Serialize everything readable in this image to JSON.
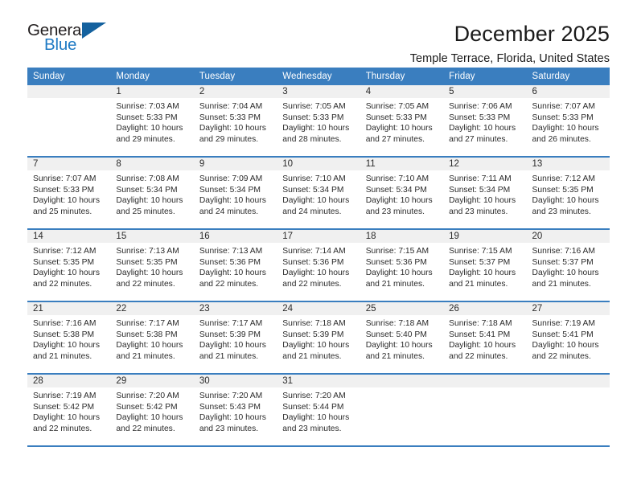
{
  "logo": {
    "word_top": "General",
    "word_bottom": "Blue",
    "triangle_color": "#14619e",
    "blue_color": "#1f7ac4"
  },
  "header": {
    "title": "December 2025",
    "location": "Temple Terrace, Florida, United States"
  },
  "theme": {
    "header_bar": "#3a7ebf",
    "daynum_strip": "#f0f0f0",
    "separator": "#3a7ebf"
  },
  "weekdays": [
    "Sunday",
    "Monday",
    "Tuesday",
    "Wednesday",
    "Thursday",
    "Friday",
    "Saturday"
  ],
  "labels": {
    "sunrise_prefix": "Sunrise:",
    "sunset_prefix": "Sunset:",
    "daylight_prefix": "Daylight:"
  },
  "weeks": [
    [
      {
        "day": "",
        "sunrise": "",
        "sunset": "",
        "daylight_line1": "",
        "daylight_line2": ""
      },
      {
        "day": "1",
        "sunrise": "Sunrise: 7:03 AM",
        "sunset": "Sunset: 5:33 PM",
        "daylight_line1": "Daylight: 10 hours",
        "daylight_line2": "and 29 minutes."
      },
      {
        "day": "2",
        "sunrise": "Sunrise: 7:04 AM",
        "sunset": "Sunset: 5:33 PM",
        "daylight_line1": "Daylight: 10 hours",
        "daylight_line2": "and 29 minutes."
      },
      {
        "day": "3",
        "sunrise": "Sunrise: 7:05 AM",
        "sunset": "Sunset: 5:33 PM",
        "daylight_line1": "Daylight: 10 hours",
        "daylight_line2": "and 28 minutes."
      },
      {
        "day": "4",
        "sunrise": "Sunrise: 7:05 AM",
        "sunset": "Sunset: 5:33 PM",
        "daylight_line1": "Daylight: 10 hours",
        "daylight_line2": "and 27 minutes."
      },
      {
        "day": "5",
        "sunrise": "Sunrise: 7:06 AM",
        "sunset": "Sunset: 5:33 PM",
        "daylight_line1": "Daylight: 10 hours",
        "daylight_line2": "and 27 minutes."
      },
      {
        "day": "6",
        "sunrise": "Sunrise: 7:07 AM",
        "sunset": "Sunset: 5:33 PM",
        "daylight_line1": "Daylight: 10 hours",
        "daylight_line2": "and 26 minutes."
      }
    ],
    [
      {
        "day": "7",
        "sunrise": "Sunrise: 7:07 AM",
        "sunset": "Sunset: 5:33 PM",
        "daylight_line1": "Daylight: 10 hours",
        "daylight_line2": "and 25 minutes."
      },
      {
        "day": "8",
        "sunrise": "Sunrise: 7:08 AM",
        "sunset": "Sunset: 5:34 PM",
        "daylight_line1": "Daylight: 10 hours",
        "daylight_line2": "and 25 minutes."
      },
      {
        "day": "9",
        "sunrise": "Sunrise: 7:09 AM",
        "sunset": "Sunset: 5:34 PM",
        "daylight_line1": "Daylight: 10 hours",
        "daylight_line2": "and 24 minutes."
      },
      {
        "day": "10",
        "sunrise": "Sunrise: 7:10 AM",
        "sunset": "Sunset: 5:34 PM",
        "daylight_line1": "Daylight: 10 hours",
        "daylight_line2": "and 24 minutes."
      },
      {
        "day": "11",
        "sunrise": "Sunrise: 7:10 AM",
        "sunset": "Sunset: 5:34 PM",
        "daylight_line1": "Daylight: 10 hours",
        "daylight_line2": "and 23 minutes."
      },
      {
        "day": "12",
        "sunrise": "Sunrise: 7:11 AM",
        "sunset": "Sunset: 5:34 PM",
        "daylight_line1": "Daylight: 10 hours",
        "daylight_line2": "and 23 minutes."
      },
      {
        "day": "13",
        "sunrise": "Sunrise: 7:12 AM",
        "sunset": "Sunset: 5:35 PM",
        "daylight_line1": "Daylight: 10 hours",
        "daylight_line2": "and 23 minutes."
      }
    ],
    [
      {
        "day": "14",
        "sunrise": "Sunrise: 7:12 AM",
        "sunset": "Sunset: 5:35 PM",
        "daylight_line1": "Daylight: 10 hours",
        "daylight_line2": "and 22 minutes."
      },
      {
        "day": "15",
        "sunrise": "Sunrise: 7:13 AM",
        "sunset": "Sunset: 5:35 PM",
        "daylight_line1": "Daylight: 10 hours",
        "daylight_line2": "and 22 minutes."
      },
      {
        "day": "16",
        "sunrise": "Sunrise: 7:13 AM",
        "sunset": "Sunset: 5:36 PM",
        "daylight_line1": "Daylight: 10 hours",
        "daylight_line2": "and 22 minutes."
      },
      {
        "day": "17",
        "sunrise": "Sunrise: 7:14 AM",
        "sunset": "Sunset: 5:36 PM",
        "daylight_line1": "Daylight: 10 hours",
        "daylight_line2": "and 22 minutes."
      },
      {
        "day": "18",
        "sunrise": "Sunrise: 7:15 AM",
        "sunset": "Sunset: 5:36 PM",
        "daylight_line1": "Daylight: 10 hours",
        "daylight_line2": "and 21 minutes."
      },
      {
        "day": "19",
        "sunrise": "Sunrise: 7:15 AM",
        "sunset": "Sunset: 5:37 PM",
        "daylight_line1": "Daylight: 10 hours",
        "daylight_line2": "and 21 minutes."
      },
      {
        "day": "20",
        "sunrise": "Sunrise: 7:16 AM",
        "sunset": "Sunset: 5:37 PM",
        "daylight_line1": "Daylight: 10 hours",
        "daylight_line2": "and 21 minutes."
      }
    ],
    [
      {
        "day": "21",
        "sunrise": "Sunrise: 7:16 AM",
        "sunset": "Sunset: 5:38 PM",
        "daylight_line1": "Daylight: 10 hours",
        "daylight_line2": "and 21 minutes."
      },
      {
        "day": "22",
        "sunrise": "Sunrise: 7:17 AM",
        "sunset": "Sunset: 5:38 PM",
        "daylight_line1": "Daylight: 10 hours",
        "daylight_line2": "and 21 minutes."
      },
      {
        "day": "23",
        "sunrise": "Sunrise: 7:17 AM",
        "sunset": "Sunset: 5:39 PM",
        "daylight_line1": "Daylight: 10 hours",
        "daylight_line2": "and 21 minutes."
      },
      {
        "day": "24",
        "sunrise": "Sunrise: 7:18 AM",
        "sunset": "Sunset: 5:39 PM",
        "daylight_line1": "Daylight: 10 hours",
        "daylight_line2": "and 21 minutes."
      },
      {
        "day": "25",
        "sunrise": "Sunrise: 7:18 AM",
        "sunset": "Sunset: 5:40 PM",
        "daylight_line1": "Daylight: 10 hours",
        "daylight_line2": "and 21 minutes."
      },
      {
        "day": "26",
        "sunrise": "Sunrise: 7:18 AM",
        "sunset": "Sunset: 5:41 PM",
        "daylight_line1": "Daylight: 10 hours",
        "daylight_line2": "and 22 minutes."
      },
      {
        "day": "27",
        "sunrise": "Sunrise: 7:19 AM",
        "sunset": "Sunset: 5:41 PM",
        "daylight_line1": "Daylight: 10 hours",
        "daylight_line2": "and 22 minutes."
      }
    ],
    [
      {
        "day": "28",
        "sunrise": "Sunrise: 7:19 AM",
        "sunset": "Sunset: 5:42 PM",
        "daylight_line1": "Daylight: 10 hours",
        "daylight_line2": "and 22 minutes."
      },
      {
        "day": "29",
        "sunrise": "Sunrise: 7:20 AM",
        "sunset": "Sunset: 5:42 PM",
        "daylight_line1": "Daylight: 10 hours",
        "daylight_line2": "and 22 minutes."
      },
      {
        "day": "30",
        "sunrise": "Sunrise: 7:20 AM",
        "sunset": "Sunset: 5:43 PM",
        "daylight_line1": "Daylight: 10 hours",
        "daylight_line2": "and 23 minutes."
      },
      {
        "day": "31",
        "sunrise": "Sunrise: 7:20 AM",
        "sunset": "Sunset: 5:44 PM",
        "daylight_line1": "Daylight: 10 hours",
        "daylight_line2": "and 23 minutes."
      },
      {
        "day": "",
        "sunrise": "",
        "sunset": "",
        "daylight_line1": "",
        "daylight_line2": ""
      },
      {
        "day": "",
        "sunrise": "",
        "sunset": "",
        "daylight_line1": "",
        "daylight_line2": ""
      },
      {
        "day": "",
        "sunrise": "",
        "sunset": "",
        "daylight_line1": "",
        "daylight_line2": ""
      }
    ]
  ]
}
